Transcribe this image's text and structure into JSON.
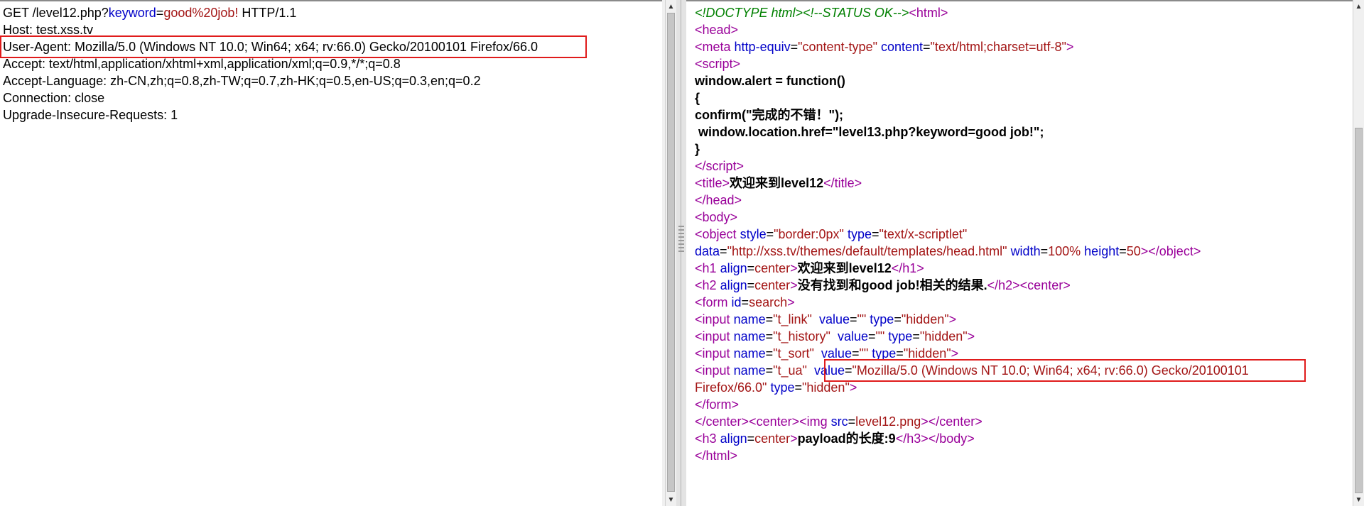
{
  "request": {
    "line1": {
      "prefix": "GET /level12.php?",
      "param": "keyword",
      "eq": "=",
      "value": "good%20job!",
      "suffix": " HTTP/1.1"
    },
    "host": "Host: test.xss.tv",
    "user_agent": "User-Agent: Mozilla/5.0 (Windows NT 10.0; Win64; x64; rv:66.0) Gecko/20100101 Firefox/66.0",
    "accept": "Accept: text/html,application/xhtml+xml,application/xml;q=0.9,*/*;q=0.8",
    "accept_language": "Accept-Language: zh-CN,zh;q=0.8,zh-TW;q=0.7,zh-HK;q=0.5,en-US;q=0.3,en;q=0.2",
    "connection": "Connection: close",
    "upgrade": "Upgrade-Insecure-Requests: 1"
  },
  "response": {
    "doctype": "<!DOCTYPE html>",
    "comment": "<!--STATUS OK-->",
    "meta_content_val": "\"text/html;charset=utf-8\"",
    "script_line1": "window.alert = function()",
    "script_line2": "{",
    "script_line3": "confirm(\"完成的不错！\");",
    "script_line4": " window.location.href=\"level13.php?keyword=good job!\";",
    "script_line5": "}",
    "title_text": "欢迎来到level12",
    "object_style": "\"border:0px\"",
    "object_type": "\"text/x-scriptlet\"",
    "object_data": "\"http://xss.tv/themes/default/templates/head.html\"",
    "object_width": "100%",
    "object_height": "50",
    "h1_text": "欢迎来到level12",
    "h2_text": "没有找到和good job!相关的结果.",
    "form_id": "search",
    "input1_name": "\"t_link\"",
    "input2_name": "\"t_history\"",
    "input3_name": "\"t_sort\"",
    "input4_name": "\"t_ua\"",
    "ua_value_part1": "\"Mozilla/5.0 (Windows NT 10.0; Win64; x64; rv:66.0) Gecko/20100101",
    "ua_value_part2": "Firefox/66.0\"",
    "empty_val": "\"\"",
    "hidden_val": "\"hidden\"",
    "img_src": "level12.png",
    "h3_text": "payload的长度:9"
  }
}
